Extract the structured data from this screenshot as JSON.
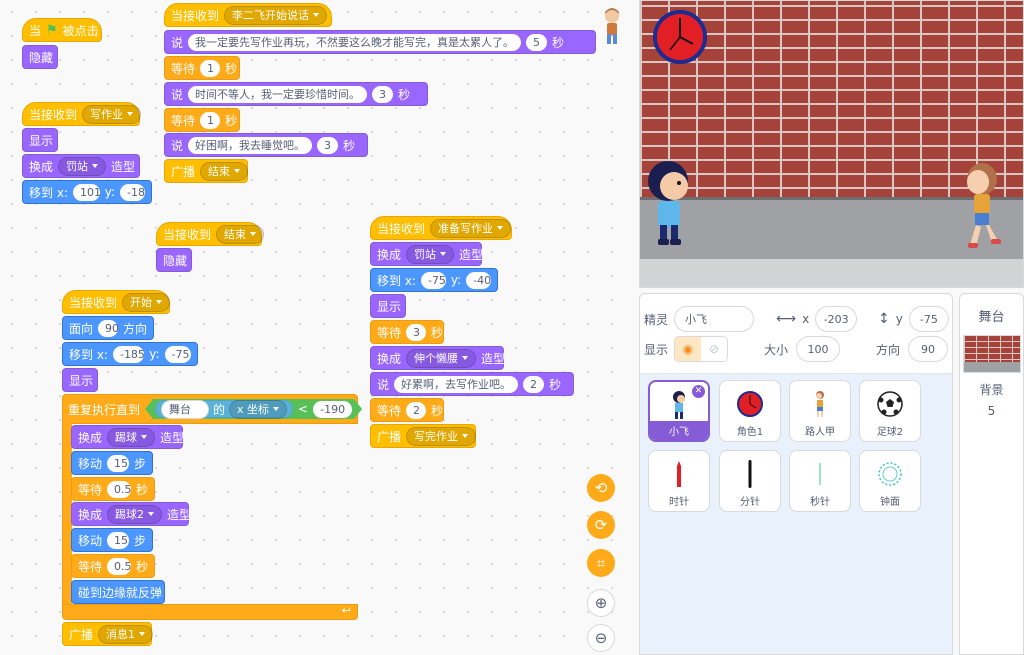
{
  "scripts": {
    "flag_script": {
      "when": "当",
      "clicked": "被点击",
      "hide": "隐藏"
    },
    "homework_script": {
      "when_receive": "当接收到",
      "message": "写作业",
      "show": "显示",
      "switch": "换成",
      "costume": "罚站",
      "costume_suffix": "造型",
      "goto": "移到 x:",
      "x": "101",
      "y_label": "y:",
      "y": "-18"
    },
    "talk_script": {
      "when_receive": "当接收到",
      "message": "李二飞开始说话",
      "say_label": "说",
      "sec_label": "秒",
      "wait_label": "等待",
      "say1": "我一定要先写作业再玩，不然要这么晚才能写完，真是太累人了。",
      "say1_secs": "5",
      "wait1": "1",
      "say2": "时间不等人，我一定要珍惜时间。",
      "say2_secs": "3",
      "wait2": "1",
      "say3": "好困啊，我去睡觉吧。",
      "say3_secs": "3",
      "broadcast_label": "广播",
      "broadcast_msg": "结束"
    },
    "end_script": {
      "when_receive": "当接收到",
      "message": "结束",
      "hide": "隐藏"
    },
    "prep_script": {
      "when_receive": "当接收到",
      "message": "准备写作业",
      "switch": "换成",
      "costume": "罚站",
      "costume_suffix": "造型",
      "goto": "移到 x:",
      "x": "-75",
      "y_label": "y:",
      "y": "-40",
      "show": "显示",
      "wait_label": "等待",
      "sec_label": "秒",
      "wait1": "3",
      "costume2": "伸个懒腰",
      "say_label": "说",
      "say1": "好累啊，去写作业吧。",
      "say1_secs": "2",
      "wait2": "2",
      "broadcast_label": "广播",
      "broadcast_msg": "写完作业"
    },
    "start_script": {
      "when_receive": "当接收到",
      "message": "开始",
      "point_label": "面向",
      "direction": "90",
      "direction_suffix": "方向",
      "goto": "移到 x:",
      "x": "-185",
      "y_label": "y:",
      "y": "-75",
      "show": "显示",
      "repeat_until": "重复执行直到",
      "sense_target": "舞台",
      "sense_of": "的",
      "sense_prop": "x 坐标",
      "lt": "<",
      "compare_value": "-190",
      "switch": "换成",
      "costume1": "踢球",
      "costume2": "踢球2",
      "costume_suffix": "造型",
      "move_label": "移动",
      "steps": "15",
      "steps_suffix": "步",
      "wait_label": "等待",
      "wait_secs": "0.5",
      "sec_label": "秒",
      "bounce": "碰到边缘就反弹",
      "broadcast_label": "广播",
      "broadcast_msg": "消息1",
      "loop_arrow": "↩"
    }
  },
  "sprite_info": {
    "sprite_label": "精灵",
    "sprite_name": "小飞",
    "x_label": "x",
    "x": "-203",
    "y_label": "y",
    "y": "-75",
    "show_label": "显示",
    "size_label": "大小",
    "size": "100",
    "direction_label": "方向",
    "direction": "90"
  },
  "sprites": [
    {
      "name": "小飞",
      "icon": "boy-sprite-icon",
      "selected": true
    },
    {
      "name": "角色1",
      "icon": "clock-face-icon"
    },
    {
      "name": "路人甲",
      "icon": "girl-sprite-icon"
    },
    {
      "name": "足球2",
      "icon": "soccer-ball-icon"
    },
    {
      "name": "时针",
      "icon": "hour-hand-icon"
    },
    {
      "name": "分针",
      "icon": "minute-hand-icon"
    },
    {
      "name": "秒针",
      "icon": "second-hand-icon"
    },
    {
      "name": "钟面",
      "icon": "dial-icon"
    }
  ],
  "stage_pane": {
    "title": "舞台",
    "backdrop_label": "背景",
    "backdrop_count": "5"
  },
  "colors": {
    "events": "#ffbf00",
    "looks": "#9966ff",
    "motion": "#4c97ff",
    "control": "#ffab19",
    "sensing": "#5cb1d6",
    "operator": "#59c059",
    "selected": "#855cd6"
  }
}
